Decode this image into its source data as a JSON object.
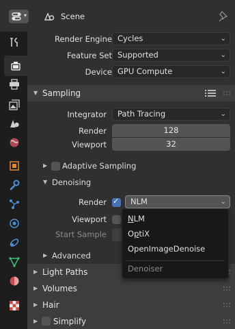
{
  "header": {
    "editor_icon": "properties-editor-icon",
    "scene_icon": "scene-icon",
    "title": "Scene",
    "pin_icon": "pin-icon"
  },
  "tabs": [
    {
      "name": "tool",
      "icon": "wrench-screwdriver-icon",
      "active": false
    },
    {
      "name": "render",
      "icon": "camera-back-icon",
      "active": true
    },
    {
      "name": "output",
      "icon": "printer-icon",
      "active": false
    },
    {
      "name": "view-layer",
      "icon": "image-stack-icon",
      "active": false
    },
    {
      "name": "scene",
      "icon": "scene-cone-sphere-icon",
      "active": false
    },
    {
      "name": "world",
      "icon": "world-globe-icon",
      "active": false
    },
    {
      "name": "object",
      "icon": "object-square-icon",
      "active": false
    },
    {
      "name": "modifiers",
      "icon": "wrench-icon",
      "active": false
    },
    {
      "name": "particles",
      "icon": "particles-icon",
      "active": false
    },
    {
      "name": "physics",
      "icon": "physics-orbit-icon",
      "active": false
    },
    {
      "name": "constraints",
      "icon": "constraint-link-icon",
      "active": false
    },
    {
      "name": "data",
      "icon": "mesh-data-triangle-icon",
      "active": false
    },
    {
      "name": "material",
      "icon": "material-sphere-icon",
      "active": false
    },
    {
      "name": "texture",
      "icon": "checker-texture-icon",
      "active": false
    }
  ],
  "render": {
    "engine_label": "Render Engine",
    "engine_value": "Cycles",
    "feature_label": "Feature Set",
    "feature_value": "Supported",
    "device_label": "Device",
    "device_value": "GPU Compute"
  },
  "sampling": {
    "title": "Sampling",
    "integrator_label": "Integrator",
    "integrator_value": "Path Tracing",
    "render_label": "Render",
    "render_value": "128",
    "viewport_label": "Viewport",
    "viewport_value": "32",
    "adaptive_label": "Adaptive Sampling"
  },
  "denoising": {
    "title": "Denoising",
    "render_label": "Render",
    "render_checked": true,
    "render_value": "NLM",
    "viewport_label": "Viewport",
    "viewport_checked": false,
    "start_sample_label": "Start Sample"
  },
  "advanced": {
    "title": "Advanced"
  },
  "panels": {
    "light_paths": "Light Paths",
    "volumes": "Volumes",
    "hair": "Hair",
    "simplify": "Simplify"
  },
  "popup": {
    "options": [
      {
        "label": "NLM",
        "underline_index": 0
      },
      {
        "label": "OptiX",
        "underline_index": 1
      },
      {
        "label": "OpenImageDenoise",
        "underline_index": -1
      }
    ],
    "title": "Denoiser"
  },
  "colors": {
    "background": "#303030",
    "tab_strip": "#1d1d1d",
    "panel_header": "#3d3d3d",
    "field": "#545454",
    "accent": "#4772b3",
    "menu": "#181818"
  }
}
